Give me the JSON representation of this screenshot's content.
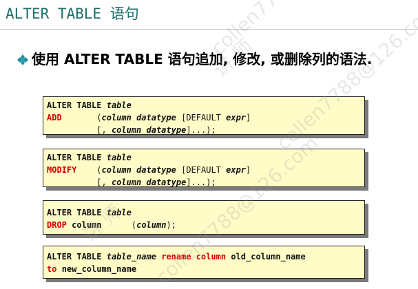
{
  "slide": {
    "title_en": "ALTER TABLE",
    "title_cn": "语句",
    "bullet": "使用 ALTER TABLE 语句追加, 修改, 或删除列的语法.",
    "bullet_icon": "diamond-bullet-icon"
  },
  "code_boxes": {
    "add": {
      "line1_kw": "ALTER TABLE",
      "line1_arg": "table",
      "line2_kw": "ADD",
      "line2_open": "(",
      "line2_col": "column datatype",
      "line2_default": " [DEFAULT ",
      "line2_expr": "expr",
      "line2_close": "]",
      "line3_pad": "[, ",
      "line3_col": "column datatype",
      "line3_close": "]...);"
    },
    "modify": {
      "line1_kw": "ALTER TABLE",
      "line1_arg": "table",
      "line2_kw": "MODIFY",
      "line2_open": "(",
      "line2_col": "column datatype",
      "line2_default": " [DEFAULT ",
      "line2_expr": "expr",
      "line2_close": "]",
      "line3_pad": "[, ",
      "line3_col": "column datatype",
      "line3_close": "]...);"
    },
    "drop": {
      "line1_kw": "ALTER TABLE",
      "line1_arg": "table",
      "line2_kw": "DROP",
      "line2_col": "column",
      "line2_open": "(",
      "line2_arg": "column",
      "line2_close": ");"
    },
    "rename": {
      "line1_kw": "ALTER TABLE",
      "line1_arg": "table_name",
      "line1_rename": "rename column",
      "line1_old": "old_column_name",
      "line2_to": "to",
      "line2_new": "new_column_name"
    }
  },
  "watermarks": [
    "collen7788@126.com",
    "讲 师",
    "collen7788@126.com",
    "讲 师",
    "collen7788@126.com"
  ]
}
